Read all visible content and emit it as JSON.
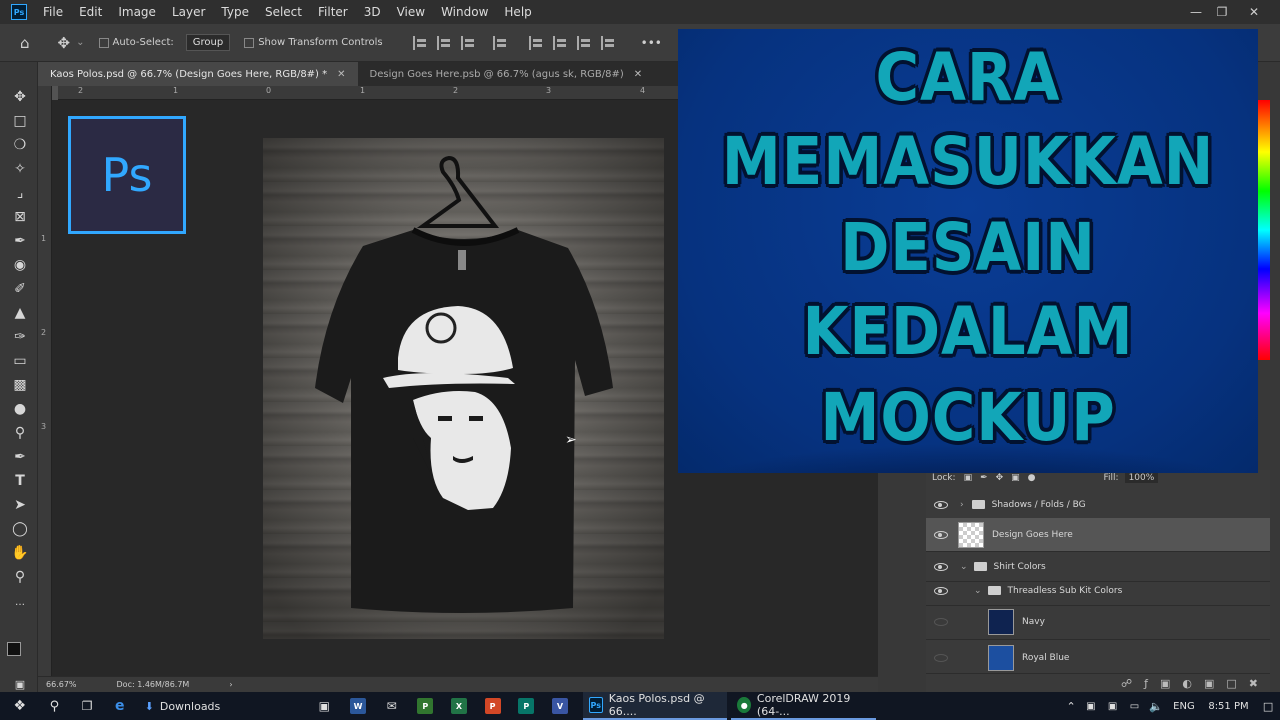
{
  "menubar": {
    "app_logo": "Ps",
    "items": [
      "File",
      "Edit",
      "Image",
      "Layer",
      "Type",
      "Select",
      "Filter",
      "3D",
      "View",
      "Window",
      "Help"
    ]
  },
  "options": {
    "auto_select_label": "Auto-Select:",
    "auto_select_value": "Group",
    "show_transform_label": "Show Transform Controls",
    "more_label": "•••"
  },
  "tabs": [
    {
      "label": "Kaos Polos.psd @ 66.7% (Design Goes Here, RGB/8#) *"
    },
    {
      "label": "Design Goes Here.psb @ 66.7% (agus sk, RGB/8#)"
    }
  ],
  "rulers": {
    "top": [
      "2",
      "1",
      "0",
      "1",
      "2",
      "3",
      "4"
    ],
    "left": [
      "1",
      "2",
      "3"
    ]
  },
  "ps_badge": "Ps",
  "status": {
    "zoom": "66.67%",
    "doc": "Doc: 1.46M/86.7M"
  },
  "overlay": {
    "lines": [
      "CARA",
      "MEMASUKKAN",
      "DESAIN",
      "KEDALAM",
      "MOCKUP"
    ]
  },
  "layers_panel": {
    "lock_label": "Lock:",
    "fill_label": "Fill:",
    "fill_value": "100%",
    "rows": [
      {
        "label": "Shadows / Folds / BG"
      },
      {
        "label": "Design Goes Here"
      },
      {
        "label": "Shirt Colors"
      },
      {
        "label": "Threadless Sub Kit Colors"
      },
      {
        "label": "Navy"
      },
      {
        "label": "Royal Blue"
      }
    ]
  },
  "taskbar": {
    "downloads": "Downloads",
    "ps_task": "Kaos Polos.psd @ 66....",
    "corel_task": "CorelDRAW 2019 (64-...",
    "lang": "ENG",
    "time": "8:51 PM",
    "icons": {
      "word": "W",
      "excel": "X",
      "ppt": "P",
      "pub": "P",
      "visio": "V",
      "ps": "Ps"
    }
  },
  "colors": {
    "overlay_bg": "#06327f",
    "overlay_text": "#12a6b8",
    "ps_blue": "#31a8ff"
  }
}
